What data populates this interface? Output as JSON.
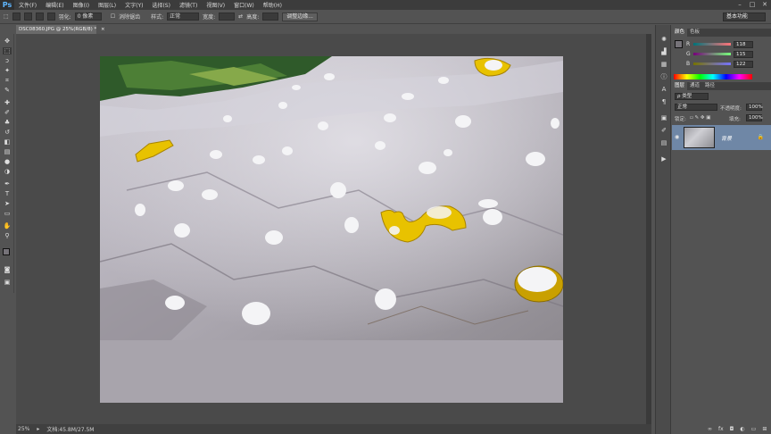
{
  "app": {
    "logo": "Ps",
    "menus": [
      "文件(F)",
      "编辑(E)",
      "图像(I)",
      "图层(L)",
      "文字(Y)",
      "选择(S)",
      "滤镜(T)",
      "视图(V)",
      "窗口(W)",
      "帮助(H)"
    ],
    "window_controls": [
      "–",
      "□",
      "✕"
    ]
  },
  "options": {
    "feather_label": "羽化:",
    "feather_value": "0 像素",
    "antialias_label": "消除锯齿",
    "style_label": "样式:",
    "style_value": "正常",
    "width_label": "宽度:",
    "height_label": "高度:",
    "refine_button": "调整边缘...",
    "workspace": "基本功能"
  },
  "document": {
    "tab_title": "DSC08360.JPG @ 25%(RGB/8) *",
    "close": "×"
  },
  "status": {
    "zoom": "25%",
    "doc_info": "文档:45.8M/27.5M"
  },
  "color_panel": {
    "tabs": [
      "颜色",
      "色板"
    ],
    "r_label": "R",
    "g_label": "G",
    "b_label": "B",
    "r_value": "118",
    "g_value": "115",
    "b_value": "122"
  },
  "layers_panel": {
    "tabs": [
      "图层",
      "通道",
      "路径"
    ],
    "kind_filter": "ρ 类型",
    "blend_mode": "正常",
    "opacity_label": "不透明度:",
    "opacity_value": "100%",
    "lock_label": "锁定:",
    "fill_label": "填充:",
    "fill_value": "100%",
    "layer_name": "背景",
    "footer_icons": [
      "∞",
      "fx",
      "◘",
      "◐",
      "▭",
      "⊞",
      "🗑"
    ]
  },
  "colors": {
    "foreground": "#767379",
    "background": "#ffffff"
  }
}
